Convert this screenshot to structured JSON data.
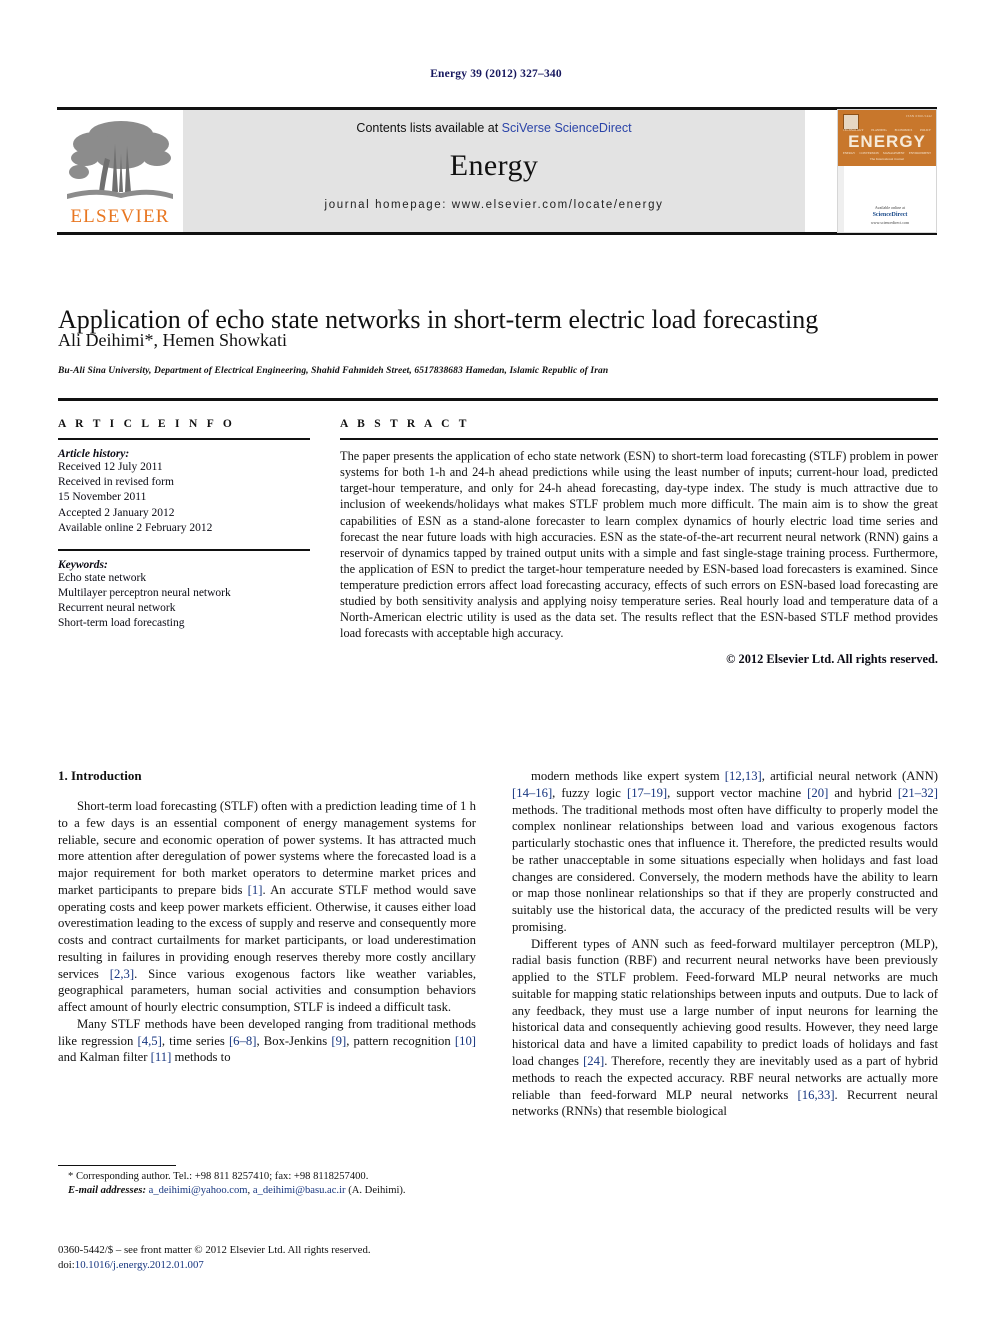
{
  "running_head": "Energy 39 (2012) 327–340",
  "masthead": {
    "contents_prefix": "Contents lists available at ",
    "sciencedirect": "SciVerse ScienceDirect",
    "journal_title": "Energy",
    "homepage": "journal homepage: www.elsevier.com/locate/energy",
    "elsevier_wordmark": "ELSEVIER",
    "logo_icon": "elsevier-tree-logo",
    "cover": {
      "title": "ENERGY",
      "issn": "ISSN 0360-5442",
      "tagline": "The International Journal",
      "keywords_top": [
        "TECHNOLOGY",
        "PLANNING",
        "ECONOMICS",
        "POLICY"
      ],
      "keywords_bottom": [
        "ENERGY",
        "CONVERSION",
        "MANAGEMENT",
        "ENVIRONMENT"
      ],
      "available_at": "Available online at",
      "sciencedirect": "ScienceDirect",
      "url": "www.sciencedirect.com"
    }
  },
  "article": {
    "title": "Application of echo state networks in short-term electric load forecasting",
    "authors": "Ali Deihimi*, Hemen Showkati",
    "affiliation": "Bu-Ali Sina University, Department of Electrical Engineering, Shahid Fahmideh Street, 6517838683 Hamedan, Islamic Republic of Iran"
  },
  "article_info": {
    "heading": "A R T I C L E   I N F O",
    "history_label": "Article history:",
    "history": [
      "Received 12 July 2011",
      "Received in revised form",
      "15 November 2011",
      "Accepted 2 January 2012",
      "Available online 2 February 2012"
    ],
    "keywords_label": "Keywords:",
    "keywords": [
      "Echo state network",
      "Multilayer perceptron neural network",
      "Recurrent neural network",
      "Short-term load forecasting"
    ]
  },
  "abstract": {
    "heading": "A B S T R A C T",
    "text": "The paper presents the application of echo state network (ESN) to short-term load forecasting (STLF) problem in power systems for both 1-h and 24-h ahead predictions while using the least number of inputs; current-hour load, predicted target-hour temperature, and only for 24-h ahead forecasting, day-type index. The study is much attractive due to inclusion of weekends/holidays what makes STLF problem much more difficult. The main aim is to show the great capabilities of ESN as a stand-alone forecaster to learn complex dynamics of hourly electric load time series and forecast the near future loads with high accuracies. ESN as the state-of-the-art recurrent neural network (RNN) gains a reservoir of dynamics tapped by trained output units with a simple and fast single-stage training process. Furthermore, the application of ESN to predict the target-hour temperature needed by ESN-based load forecasters is examined. Since temperature prediction errors affect load forecasting accuracy, effects of such errors on ESN-based load forecasting are studied by both sensitivity analysis and applying noisy temperature series. Real hourly load and temperature data of a North-American electric utility is used as the data set. The results reflect that the ESN-based STLF method provides load forecasts with acceptable high accuracy.",
    "copyright": "© 2012 Elsevier Ltd. All rights reserved."
  },
  "body": {
    "section_heading": "1. Introduction",
    "left_paragraphs": [
      "Short-term load forecasting (STLF) often with a prediction leading time of 1 h to a few days is an essential component of energy management systems for reliable, secure and economic operation of power systems. It has attracted much more attention after deregulation of power systems where the forecasted load is a major requirement for both market operators to determine market prices and market participants to prepare bids [1]. An accurate STLF method would save operating costs and keep power markets efficient. Otherwise, it causes either load overestimation leading to the excess of supply and reserve and consequently more costs and contract curtailments for market participants, or load underestimation resulting in failures in providing enough reserves thereby more costly ancillary services [2,3]. Since various exogenous factors like weather variables, geographical parameters, human social activities and consumption behaviors affect amount of hourly electric consumption, STLF is indeed a difficult task.",
      "Many STLF methods have been developed ranging from traditional methods like regression [4,5], time series [6–8], Box-Jenkins [9], pattern recognition [10] and Kalman filter [11] methods to"
    ],
    "right_paragraphs": [
      "modern methods like expert system [12,13], artificial neural network (ANN) [14–16], fuzzy logic [17–19], support vector machine [20] and hybrid [21–32] methods. The traditional methods most often have difficulty to properly model the complex nonlinear relationships between load and various exogenous factors particularly stochastic ones that influence it. Therefore, the predicted results would be rather unacceptable in some situations especially when holidays and fast load changes are considered. Conversely, the modern methods have the ability to learn or map those nonlinear relationships so that if they are properly constructed and suitably use the historical data, the accuracy of the predicted results will be very promising.",
      "Different types of ANN such as feed-forward multilayer perceptron (MLP), radial basis function (RBF) and recurrent neural networks have been previously applied to the STLF problem. Feed-forward MLP neural networks are much suitable for mapping static relationships between inputs and outputs. Due to lack of any feedback, they must use a large number of input neurons for learning the historical data and consequently achieving good results. However, they need large historical data and have a limited capability to predict loads of holidays and fast load changes [24]. Therefore, recently they are inevitably used as a part of hybrid methods to reach the expected accuracy. RBF neural networks are actually more reliable than feed-forward MLP neural networks [16,33]. Recurrent neural networks (RNNs) that resemble biological"
    ]
  },
  "footnote": {
    "corresponding": "* Corresponding author. Tel.: +98 811 8257410; fax: +98 8118257400.",
    "email_label": "E-mail addresses:",
    "email1": "a_deihimi@yahoo.com",
    "email_sep": ", ",
    "email2": "a_deihimi@basu.ac.ir",
    "email_suffix": " (A. Deihimi)."
  },
  "imprint": {
    "line1": "0360-5442/$ – see front matter © 2012 Elsevier Ltd. All rights reserved.",
    "doi_label": "doi:",
    "doi": "10.1016/j.energy.2012.01.007"
  },
  "colors": {
    "link": "#16357f",
    "running_head": "#16175e",
    "elsevier_orange": "#e87722",
    "sciencedirect_blue": "#2b44a8",
    "panel_grey": "#e3e3e3"
  }
}
